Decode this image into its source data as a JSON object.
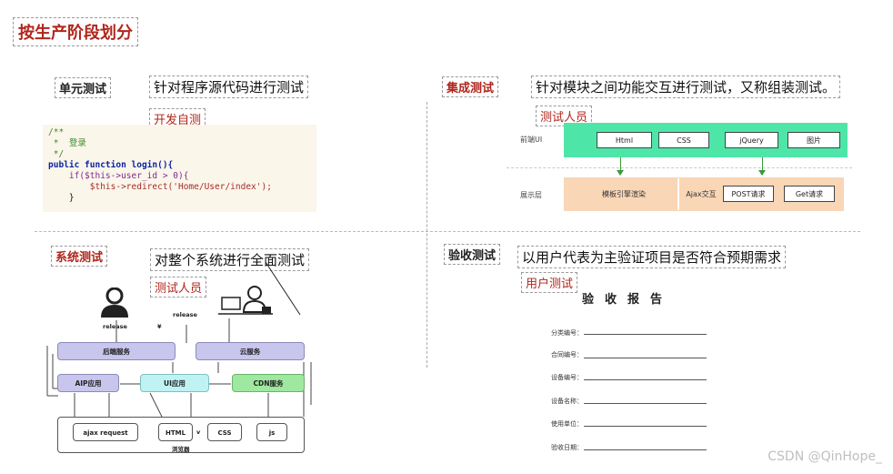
{
  "title": "按生产阶段划分",
  "unit_test": {
    "label": "单元测试",
    "desc": "针对程序源代码进行测试",
    "who": "开发自测",
    "code_lines": [
      "/**",
      " *  登录",
      " */",
      "public function login(){",
      "    if($this->user_id > 0){",
      "        $this->redirect('Home/User/index');",
      "    }"
    ]
  },
  "integration_test": {
    "label": "集成测试",
    "desc": "针对模块之间功能交互进行测试，又称组装测试。",
    "who": "测试人员",
    "row_ui": "前端UI",
    "row_show": "展示层",
    "ui_items": [
      "Html",
      "CSS",
      "jQuery",
      "图片"
    ],
    "show_left": "模板引擎渲染",
    "show_mid": "Ajax交互",
    "show_items": [
      "POST请求",
      "Get请求"
    ]
  },
  "system_test": {
    "label": "系统测试",
    "desc": "对整个系统进行全面测试",
    "who": "测试人员",
    "release1": "release",
    "release2": "release",
    "yen": "¥",
    "backend": "后端服务",
    "cloud": "云服务",
    "aip": "AIP应用",
    "ui_app": "UI应用",
    "cdn": "CDN服务",
    "ajax": "ajax request",
    "html": "HTML",
    "v": "v",
    "css": "CSS",
    "js": "js",
    "browser": "浏览器"
  },
  "acceptance_test": {
    "label": "验收测试",
    "desc": "以用户代表为主验证项目是否符合预期需求",
    "who": "用户测试",
    "report_title": "验收报告",
    "fields": [
      "分类编号：",
      "合同编号：",
      "设备编号：",
      "设备名称：",
      "使用单位：",
      "验收日期："
    ]
  },
  "watermark": "CSDN @QinHope_",
  "colors": {
    "accent_red": "#b0261c",
    "ui_band": "#4ee6a8",
    "show_band": "#f8d6b6",
    "backend_box": "#c9c6ee",
    "aip_box": "#c9c6ee",
    "ui_app_box": "#bff3f3",
    "cdn_box": "#9fe89f"
  }
}
